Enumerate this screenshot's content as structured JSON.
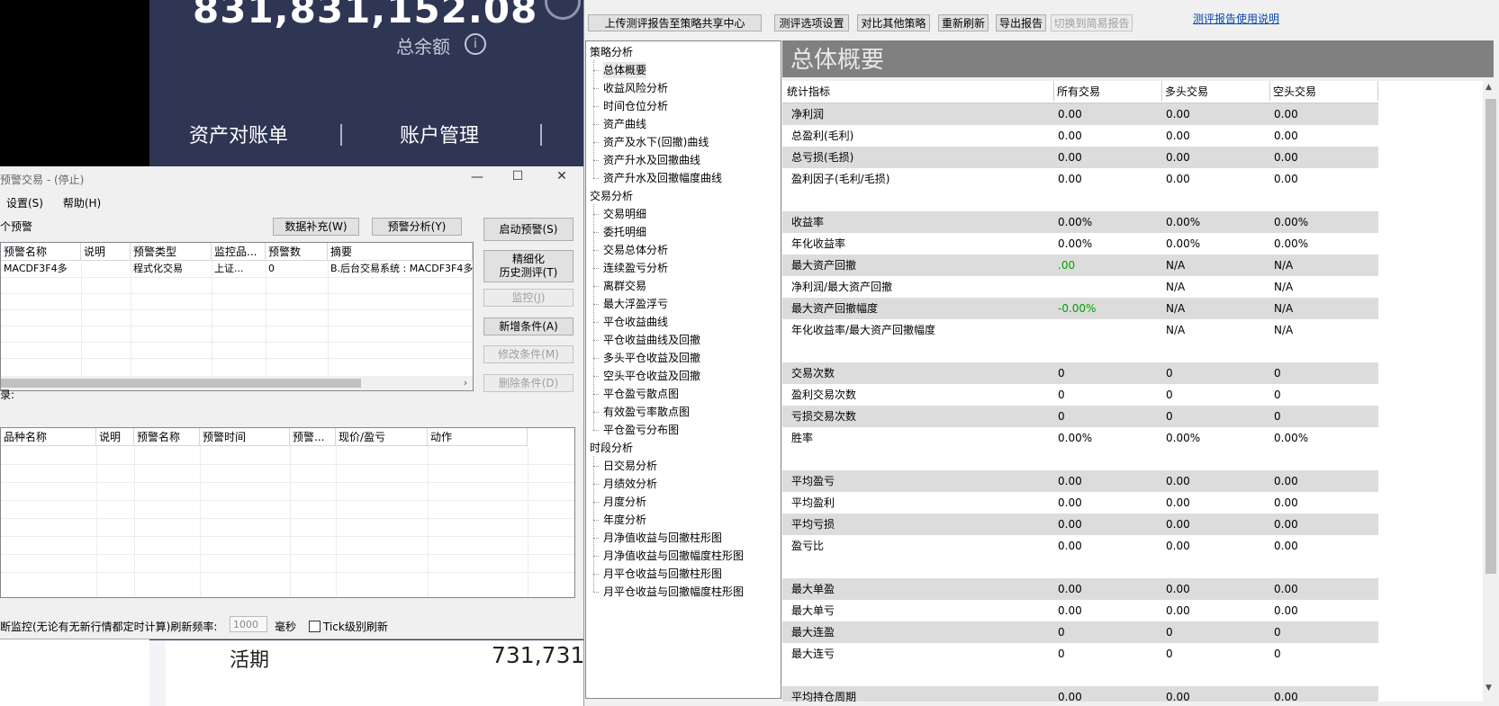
{
  "background_app": {
    "balance_value": "831,831,152.08",
    "balance_label": "总余额",
    "menu": [
      "资产对账单",
      "账户管理"
    ],
    "demand_label": "活期",
    "demand_value": "731,731"
  },
  "alert_window": {
    "title": "预警交易 - (停止)",
    "win_controls": [
      "—",
      "☐",
      "✕"
    ],
    "menu": [
      "设置(S)",
      "帮助(H)"
    ],
    "count_label": "个预警",
    "buttons": {
      "data_fill": "数据补充(W)",
      "analysis": "预警分析(Y)",
      "start": "启动预警(S)",
      "fine_test_1": "精细化",
      "fine_test_2": "历史测评(T)",
      "monitor": "监控(J)",
      "add_cond": "新增条件(A)",
      "edit_cond": "修改条件(M)",
      "del_cond": "删除条件(D)"
    },
    "table1": {
      "headers": [
        "预警名称",
        "说明",
        "预警类型",
        "监控品...",
        "预警数",
        "摘要"
      ],
      "rows": [
        [
          "MACDF3F4多",
          "",
          "程式化交易",
          "上证...",
          "0",
          "B.后台交易系统 : MACDF3F4多"
        ]
      ]
    },
    "table2_label": "录:",
    "table2": {
      "headers": [
        "品种名称",
        "说明",
        "预警名称",
        "预警时间",
        "预警...",
        "现价/盈亏",
        "动作"
      ]
    },
    "footer": {
      "text": "断监控(无论有无新行情都定时计算)刷新频率:",
      "freq_value": "1000",
      "unit": "毫秒",
      "tick_label": "Tick级别刷新"
    }
  },
  "report_window": {
    "toolbar": {
      "upload": "上传测评报告至策略共享中心",
      "options": "测评选项设置",
      "compare": "对比其他策略",
      "refresh": "重新刷新",
      "export": "导出报告",
      "simple": "切换到简易报告",
      "help_link": "测评报告使用说明"
    },
    "tree": [
      {
        "label": "策略分析",
        "level": 0
      },
      {
        "label": "总体概要",
        "level": 1,
        "selected": true
      },
      {
        "label": "收益风险分析",
        "level": 1
      },
      {
        "label": "时间仓位分析",
        "level": 1
      },
      {
        "label": "资产曲线",
        "level": 1
      },
      {
        "label": "资产及水下(回撤)曲线",
        "level": 1
      },
      {
        "label": "资产升水及回撤曲线",
        "level": 1
      },
      {
        "label": "资产升水及回撤幅度曲线",
        "level": 1
      },
      {
        "label": "交易分析",
        "level": 0
      },
      {
        "label": "交易明细",
        "level": 1
      },
      {
        "label": "委托明细",
        "level": 1
      },
      {
        "label": "交易总体分析",
        "level": 1
      },
      {
        "label": "连续盈亏分析",
        "level": 1
      },
      {
        "label": "离群交易",
        "level": 1
      },
      {
        "label": "最大浮盈浮亏",
        "level": 1
      },
      {
        "label": "平仓收益曲线",
        "level": 1
      },
      {
        "label": "平仓收益曲线及回撤",
        "level": 1
      },
      {
        "label": "多头平仓收益及回撤",
        "level": 1
      },
      {
        "label": "空头平仓收益及回撤",
        "level": 1
      },
      {
        "label": "平仓盈亏散点图",
        "level": 1
      },
      {
        "label": "有效盈亏率散点图",
        "level": 1
      },
      {
        "label": "平仓盈亏分布图",
        "level": 1
      },
      {
        "label": "时段分析",
        "level": 0
      },
      {
        "label": "日交易分析",
        "level": 1
      },
      {
        "label": "月绩效分析",
        "level": 1
      },
      {
        "label": "月度分析",
        "level": 1
      },
      {
        "label": "年度分析",
        "level": 1
      },
      {
        "label": "月净值收益与回撤柱形图",
        "level": 1
      },
      {
        "label": "月净值收益与回撤幅度柱形图",
        "level": 1
      },
      {
        "label": "月平仓收益与回撤柱形图",
        "level": 1
      },
      {
        "label": "月平仓收益与回撤幅度柱形图",
        "level": 1
      }
    ],
    "summary_title": "总体概要",
    "stats_headers": [
      "统计指标",
      "所有交易",
      "多头交易",
      "空头交易"
    ],
    "stats_rows": [
      {
        "name": "净利润",
        "all": "0.00",
        "long": "0.00",
        "short": "0.00",
        "shade": true
      },
      {
        "name": "总盈利(毛利)",
        "all": "0.00",
        "long": "0.00",
        "short": "0.00"
      },
      {
        "name": "总亏损(毛损)",
        "all": "0.00",
        "long": "0.00",
        "short": "0.00",
        "shade": true
      },
      {
        "name": "盈利因子(毛利/毛损)",
        "all": "0.00",
        "long": "0.00",
        "short": "0.00"
      },
      {
        "blank": true
      },
      {
        "name": "收益率",
        "all": "0.00%",
        "long": "0.00%",
        "short": "0.00%",
        "shade": true
      },
      {
        "name": "年化收益率",
        "all": "0.00%",
        "long": "0.00%",
        "short": "0.00%"
      },
      {
        "name": "最大资产回撤",
        "all": ".00",
        "long": "N/A",
        "short": "N/A",
        "shade": true,
        "green": true
      },
      {
        "name": "净利润/最大资产回撤",
        "all": "",
        "long": "N/A",
        "short": "N/A"
      },
      {
        "name": "最大资产回撤幅度",
        "all": "-0.00%",
        "long": "N/A",
        "short": "N/A",
        "shade": true,
        "green": true
      },
      {
        "name": "年化收益率/最大资产回撤幅度",
        "all": "",
        "long": "N/A",
        "short": "N/A"
      },
      {
        "blank": true
      },
      {
        "name": "交易次数",
        "all": "0",
        "long": "0",
        "short": "0",
        "shade": true
      },
      {
        "name": "盈利交易次数",
        "all": "0",
        "long": "0",
        "short": "0"
      },
      {
        "name": "亏损交易次数",
        "all": "0",
        "long": "0",
        "short": "0",
        "shade": true
      },
      {
        "name": "胜率",
        "all": "0.00%",
        "long": "0.00%",
        "short": "0.00%"
      },
      {
        "blank": true
      },
      {
        "name": "平均盈亏",
        "all": "0.00",
        "long": "0.00",
        "short": "0.00",
        "shade": true
      },
      {
        "name": "平均盈利",
        "all": "0.00",
        "long": "0.00",
        "short": "0.00"
      },
      {
        "name": "平均亏损",
        "all": "0.00",
        "long": "0.00",
        "short": "0.00",
        "shade": true
      },
      {
        "name": "盈亏比",
        "all": "0.00",
        "long": "0.00",
        "short": "0.00"
      },
      {
        "blank": true
      },
      {
        "name": "最大单盈",
        "all": "0.00",
        "long": "0.00",
        "short": "0.00",
        "shade": true
      },
      {
        "name": "最大单亏",
        "all": "0.00",
        "long": "0.00",
        "short": "0.00"
      },
      {
        "name": "最大连盈",
        "all": "0",
        "long": "0",
        "short": "0",
        "shade": true
      },
      {
        "name": "最大连亏",
        "all": "0",
        "long": "0",
        "short": "0"
      },
      {
        "blank": true
      },
      {
        "name": "平均持仓周期",
        "all": "0.00",
        "long": "0.00",
        "short": "0.00",
        "shade": true
      }
    ]
  }
}
